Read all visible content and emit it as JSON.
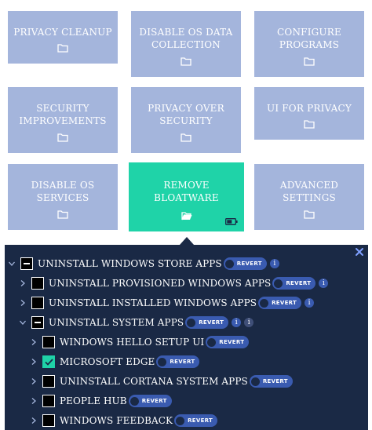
{
  "tiles": [
    {
      "label": "PRIVACY CLEANUP"
    },
    {
      "label": "DISABLE OS DATA COLLECTION"
    },
    {
      "label": "CONFIGURE PROGRAMS"
    },
    {
      "label": "SECURITY IMPROVEMENTS"
    },
    {
      "label": "PRIVACY OVER SECURITY"
    },
    {
      "label": "UI FOR PRIVACY"
    },
    {
      "label": "DISABLE OS SERVICES"
    },
    {
      "label": "REMOVE BLOATWARE",
      "selected": true
    },
    {
      "label": "ADVANCED SETTINGS"
    }
  ],
  "tree": {
    "revert_label": "REVERT",
    "info_glyph": "i",
    "rows": [
      {
        "label": "UNINSTALL WINDOWS STORE APPS",
        "state": "indeterminate",
        "expanded": true
      },
      {
        "label": "UNINSTALL PROVISIONED WINDOWS APPS",
        "state": "unchecked",
        "expanded": false
      },
      {
        "label": "UNINSTALL INSTALLED WINDOWS APPS",
        "state": "unchecked",
        "expanded": false
      },
      {
        "label": "UNINSTALL SYSTEM APPS",
        "state": "indeterminate",
        "expanded": true
      },
      {
        "label": "WINDOWS HELLO SETUP UI",
        "state": "unchecked",
        "expanded": false
      },
      {
        "label": "MICROSOFT EDGE",
        "state": "checked",
        "expanded": false
      },
      {
        "label": "UNINSTALL CORTANA SYSTEM APPS",
        "state": "unchecked",
        "expanded": false
      },
      {
        "label": "PEOPLE HUB",
        "state": "unchecked",
        "expanded": false
      },
      {
        "label": "WINDOWS FEEDBACK",
        "state": "unchecked",
        "expanded": false
      }
    ]
  },
  "colors": {
    "tile": "#a4b5dc",
    "tile_selected": "#1fd3a8",
    "panel": "#1a2945",
    "toggle": "#3a5bb0"
  }
}
